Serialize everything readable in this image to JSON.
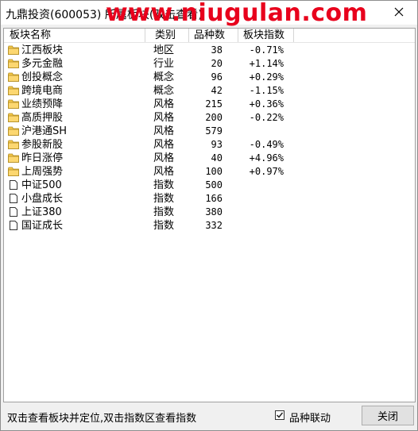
{
  "window": {
    "title": "九鼎投资(600053) 所属板块(双击查看)",
    "watermark": "www.niugulan.com"
  },
  "list": {
    "columns": {
      "name": "板块名称",
      "type": "类别",
      "count": "品种数",
      "index": "板块指数"
    },
    "rows": [
      {
        "icon": "folder-icon",
        "name": "江西板块",
        "type": "地区",
        "count": "38",
        "index": "-0.71%"
      },
      {
        "icon": "folder-icon",
        "name": "多元金融",
        "type": "行业",
        "count": "20",
        "index": "+1.14%"
      },
      {
        "icon": "folder-icon",
        "name": "创投概念",
        "type": "概念",
        "count": "96",
        "index": "+0.29%"
      },
      {
        "icon": "folder-icon",
        "name": "跨境电商",
        "type": "概念",
        "count": "42",
        "index": "-1.15%"
      },
      {
        "icon": "folder-icon",
        "name": "业绩预降",
        "type": "风格",
        "count": "215",
        "index": "+0.36%"
      },
      {
        "icon": "folder-icon",
        "name": "高质押股",
        "type": "风格",
        "count": "200",
        "index": "-0.22%"
      },
      {
        "icon": "folder-icon",
        "name": "沪港通SH",
        "type": "风格",
        "count": "579",
        "index": ""
      },
      {
        "icon": "folder-icon",
        "name": "参股新股",
        "type": "风格",
        "count": "93",
        "index": "-0.49%"
      },
      {
        "icon": "folder-icon",
        "name": "昨日涨停",
        "type": "风格",
        "count": "40",
        "index": "+4.96%"
      },
      {
        "icon": "folder-icon",
        "name": "上周强势",
        "type": "风格",
        "count": "100",
        "index": "+0.97%"
      },
      {
        "icon": "document-icon",
        "name": "中证500",
        "type": "指数",
        "count": "500",
        "index": ""
      },
      {
        "icon": "document-icon",
        "name": "小盘成长",
        "type": "指数",
        "count": "166",
        "index": ""
      },
      {
        "icon": "document-icon",
        "name": "上证380",
        "type": "指数",
        "count": "380",
        "index": ""
      },
      {
        "icon": "document-icon",
        "name": "国证成长",
        "type": "指数",
        "count": "332",
        "index": ""
      }
    ]
  },
  "footer": {
    "hint": "双击查看板块并定位,双击指数区查看指数",
    "link_label": "品种联动",
    "link_checked": true,
    "close_label": "关闭"
  },
  "colors": {
    "folder": "#f5c84a",
    "watermark": "#e8001c"
  }
}
